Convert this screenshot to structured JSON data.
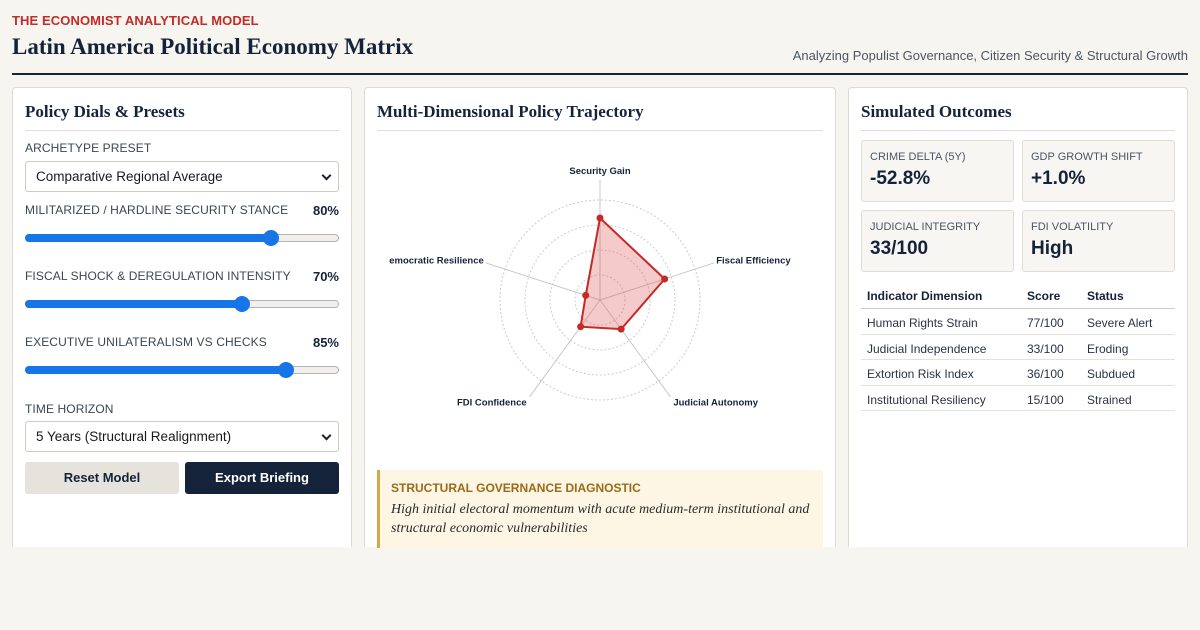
{
  "header": {
    "eyebrow": "THE ECONOMIST ANALYTICAL MODEL",
    "title": "Latin America Political Economy Matrix",
    "subtitle": "Analyzing Populist Governance, Citizen Security & Structural Growth"
  },
  "left": {
    "title": "Policy Dials & Presets",
    "preset_label": "ARCHETYPE PRESET",
    "preset_value": "Comparative Regional Average",
    "sliders": [
      {
        "label": "MILITARIZED / HARDLINE SECURITY STANCE",
        "value": 80,
        "display": "80%"
      },
      {
        "label": "FISCAL SHOCK & DEREGULATION INTENSITY",
        "value": 70,
        "display": "70%"
      },
      {
        "label": "EXECUTIVE UNILATERALISM VS CHECKS",
        "value": 85,
        "display": "85%"
      }
    ],
    "horizon_label": "TIME HORIZON",
    "horizon_value": "5 Years (Structural Realignment)",
    "reset_label": "Reset Model",
    "export_label": "Export Briefing"
  },
  "middle": {
    "title": "Multi-Dimensional Policy Trajectory",
    "radar_axes": [
      "Security Gain",
      "Fiscal Efficiency",
      "Judicial Autonomy",
      "FDI Confidence",
      "emocratic Resilience"
    ],
    "radar_values": [
      82,
      68,
      36,
      33,
      15
    ],
    "radar_max": 100,
    "diagnostic_title": "STRUCTURAL GOVERNANCE DIAGNOSTIC",
    "diagnostic_text": "High initial electoral momentum with acute medium-term institutional and structural economic vulnerabilities"
  },
  "right": {
    "title": "Simulated Outcomes",
    "cards": [
      {
        "label": "CRIME DELTA (5Y)",
        "value": "-52.8%"
      },
      {
        "label": "GDP GROWTH SHIFT",
        "value": "+1.0%"
      },
      {
        "label": "JUDICIAL INTEGRITY",
        "value": "33/100"
      },
      {
        "label": "FDI VOLATILITY",
        "value": "High"
      }
    ],
    "table": {
      "headers": [
        "Indicator Dimension",
        "Score",
        "Status"
      ],
      "rows": [
        [
          "Human Rights Strain",
          "77/100",
          "Severe Alert"
        ],
        [
          "Judicial Independence",
          "33/100",
          "Eroding"
        ],
        [
          "Extortion Risk Index",
          "36/100",
          "Subdued"
        ],
        [
          "Institutional Resiliency",
          "15/100",
          "Strained"
        ]
      ]
    }
  },
  "colors": {
    "accent_red": "#c42a27",
    "navy": "#14223a",
    "slider_blue": "#1676e8",
    "radar_fill": "#f0c4c4",
    "diag_border": "#d3a84a"
  }
}
